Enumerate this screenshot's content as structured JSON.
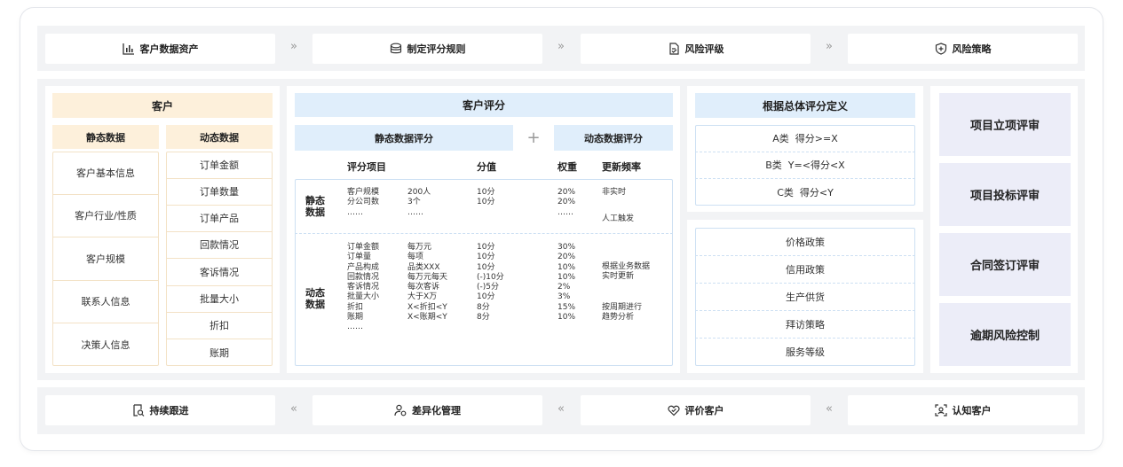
{
  "top_flow": [
    {
      "label": "客户数据资产",
      "icon": "bar-chart-icon"
    },
    {
      "label": "制定评分规则",
      "icon": "database-icon"
    },
    {
      "label": "风险评级",
      "icon": "document-check-icon"
    },
    {
      "label": "风险策略",
      "icon": "shield-icon"
    }
  ],
  "top_separator": "»",
  "bottom_flow": [
    {
      "label": "持续跟进",
      "icon": "search-doc-icon"
    },
    {
      "label": "差异化管理",
      "icon": "user-gear-icon"
    },
    {
      "label": "评价客户",
      "icon": "heart-check-icon"
    },
    {
      "label": "认知客户",
      "icon": "scan-face-icon"
    }
  ],
  "bottom_separator": "«",
  "customer": {
    "title": "客户",
    "static_header": "静态数据",
    "dynamic_header": "动态数据",
    "static_items": [
      "客户基本信息",
      "客户行业/性质",
      "客户规模",
      "联系人信息",
      "决策人信息"
    ],
    "dynamic_items": [
      "订单金额",
      "订单数量",
      "订单产品",
      "回款情况",
      "客诉情况",
      "批量大小",
      "折扣",
      "账期"
    ]
  },
  "scoring": {
    "title": "客户评分",
    "static_header": "静态数据评分",
    "plus": "+",
    "dynamic_header": "动态数据评分",
    "columns": [
      "评分项目",
      "分值",
      "权重",
      "更新频率"
    ],
    "static_group": {
      "label": "静态\n数据",
      "items": [
        "客户规模",
        "分公司数",
        "……"
      ],
      "values": [
        "200人",
        "3个",
        "……"
      ],
      "scores": [
        "10分",
        "10分",
        ""
      ],
      "weights": [
        "20%",
        "20%",
        "……"
      ],
      "freq": [
        "非实时",
        "人工触发"
      ]
    },
    "dynamic_group": {
      "label": "动态\n数据",
      "items": [
        "订单金额",
        "订单量",
        "产品构成",
        "回款情况",
        "客诉情况",
        "批量大小",
        "折扣",
        "账期",
        "……"
      ],
      "values": [
        "每万元",
        "每项",
        "品类XXX",
        "每万元每天",
        "每次客诉",
        "大于X万",
        "X<折扣<Y",
        "X<账期<Y",
        ""
      ],
      "scores": [
        "10分",
        "10分",
        "10分",
        "(-)10分",
        "(-)5分",
        "10分",
        "8分",
        "8分",
        ""
      ],
      "weights": [
        "30%",
        "20%",
        "10%",
        "10%",
        "2%",
        "3%",
        "15%",
        "10%",
        ""
      ],
      "freq": [
        "根据业务数据\n实时更新",
        "按周期进行\n趋势分析"
      ]
    }
  },
  "definition": {
    "title": "根据总体评分定义",
    "grades": [
      "A类  得分>=X",
      "B类  Y=<得分<X",
      "C类  得分<Y"
    ],
    "policies": [
      "价格政策",
      "信用政策",
      "生产供货",
      "拜访策略",
      "服务等级"
    ]
  },
  "reviews": [
    "项目立项评审",
    "项目投标评审",
    "合同签订评审",
    "逾期风险控制"
  ]
}
